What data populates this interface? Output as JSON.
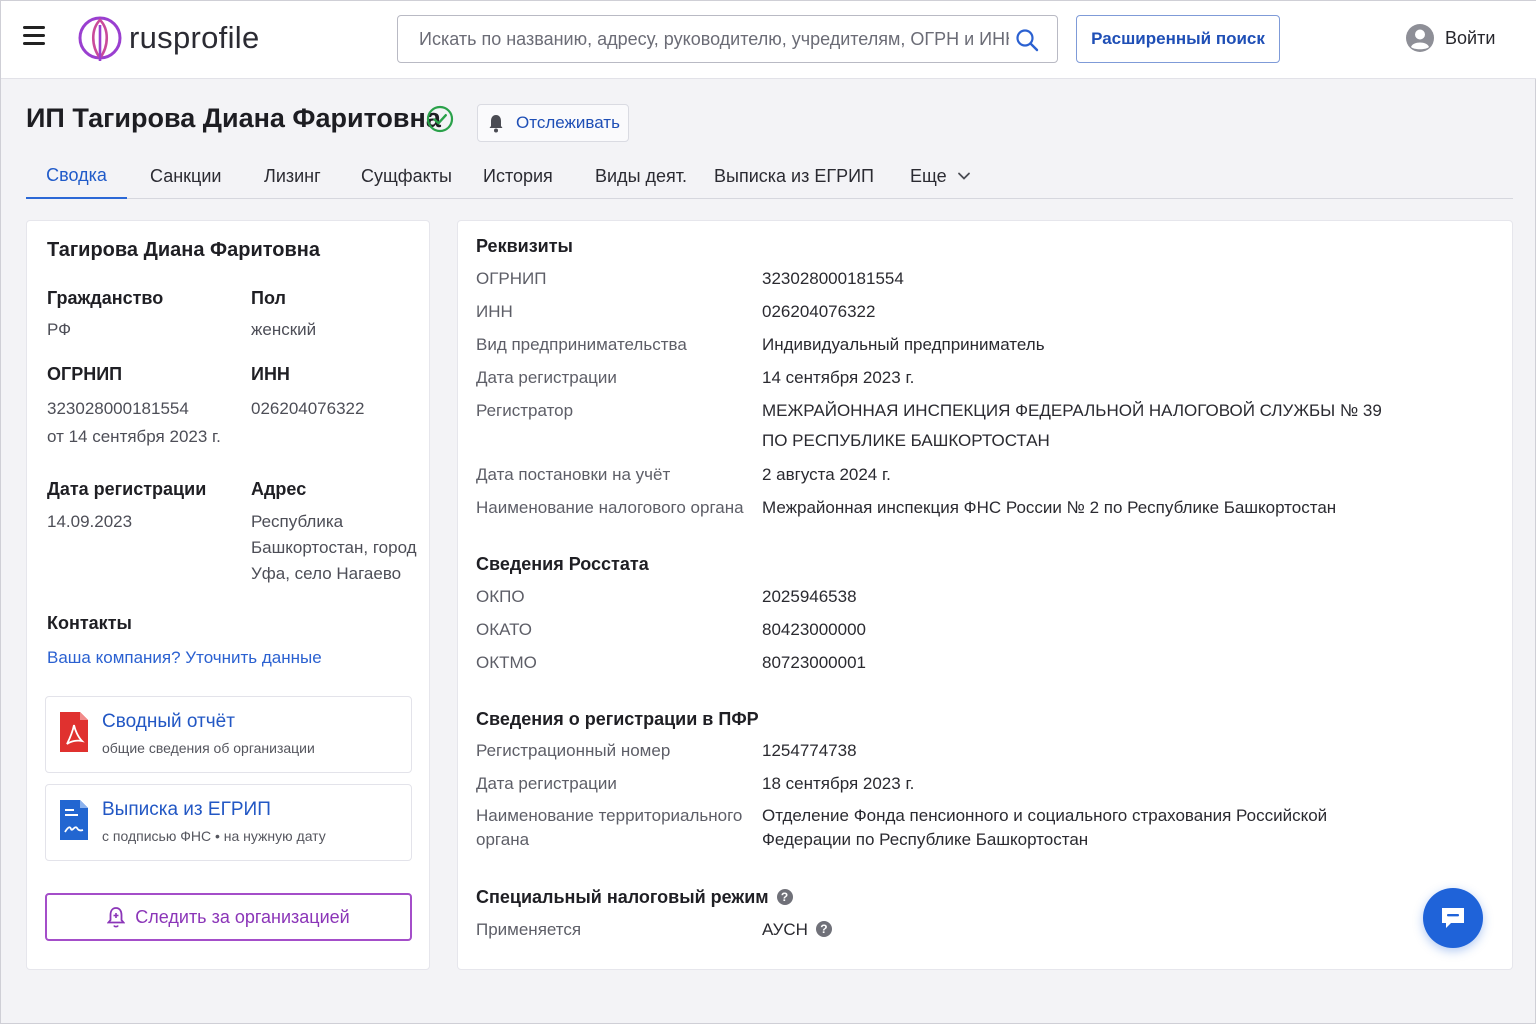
{
  "header": {
    "logo_text": "rusprofile",
    "search_placeholder": "Искать по названию, адресу, руководителю, учредителям, ОГРН и ИНН",
    "advanced_search_label": "Расширенный поиск",
    "login_label": "Войти"
  },
  "page": {
    "title": "ИП Тагирова Диана Фаритовна",
    "track_label": "Отслеживать"
  },
  "tabs": [
    {
      "label": "Сводка",
      "active": true
    },
    {
      "label": "Санкции"
    },
    {
      "label": "Лизинг"
    },
    {
      "label": "Сущфакты"
    },
    {
      "label": "История"
    },
    {
      "label": "Виды деят."
    },
    {
      "label": "Выписка из ЕГРИП"
    },
    {
      "label": "Еще"
    }
  ],
  "left": {
    "owner_name": "Тагирова Диана Фаритовна",
    "citizenship_label": "Гражданство",
    "citizenship_value": "РФ",
    "gender_label": "Пол",
    "gender_value": "женский",
    "ogrnip_label": "ОГРНИП",
    "ogrnip_value": "323028000181554",
    "ogrnip_date": "от 14 сентября 2023 г.",
    "inn_label": "ИНН",
    "inn_value": "026204076322",
    "reg_date_label": "Дата регистрации",
    "reg_date_value": "14.09.2023",
    "address_label": "Адрес",
    "address_lines": [
      "Республика",
      "Башкортостан, город",
      "Уфа, село Нагаево"
    ],
    "contacts_label": "Контакты",
    "contacts_link": "Ваша компания? Уточнить данные",
    "report_title": "Сводный отчёт",
    "report_sub": "общие сведения об организации",
    "extract_title": "Выписка из ЕГРИП",
    "extract_sub": "с подписью ФНС • на нужную дату",
    "follow_label": "Следить за организацией"
  },
  "right": {
    "requisites_title": "Реквизиты",
    "requisites": [
      {
        "key": "ОГРНИП",
        "value": "323028000181554"
      },
      {
        "key": "ИНН",
        "value": "026204076322"
      },
      {
        "key": "Вид предпринимательства",
        "value": "Индивидуальный предприниматель"
      },
      {
        "key": "Дата регистрации",
        "value": "14 сентября 2023 г."
      },
      {
        "key": "Регистратор",
        "value": "МЕЖРАЙОННАЯ ИНСПЕКЦИЯ ФЕДЕРАЛЬНОЙ НАЛОГОВОЙ СЛУЖБЫ № 39",
        "value2": "ПО РЕСПУБЛИКЕ БАШКОРТОСТАН"
      },
      {
        "key": "Дата постановки на учёт",
        "value": "2 августа 2024 г."
      },
      {
        "key": "Наименование налогового органа",
        "value": "Межрайонная инспекция ФНС России № 2 по Республике Башкортостан"
      }
    ],
    "rosstat_title": "Сведения Росстата",
    "rosstat": [
      {
        "key": "ОКПО",
        "value": "2025946538"
      },
      {
        "key": "ОКАТО",
        "value": "80423000000"
      },
      {
        "key": "ОКТМО",
        "value": "80723000001"
      }
    ],
    "pfr_title": "Сведения о регистрации в ПФР",
    "pfr": [
      {
        "key": "Регистрационный номер",
        "value": "1254774738"
      },
      {
        "key": "Дата регистрации",
        "value": "18 сентября 2023 г."
      },
      {
        "key": "Наименование территориального",
        "key2": "органа",
        "value": "Отделение Фонда пенсионного и социального страхования Российской",
        "value2": "Федерации по Республике Башкортостан"
      }
    ],
    "tax_title": "Специальный налоговый режим",
    "tax_key": "Применяется",
    "tax_value": "АУСН",
    "help_glyph": "?"
  },
  "colors": {
    "accent": "#1f5ac9",
    "follow": "#8b35b8",
    "verified": "#2aa14a",
    "pdf_red": "#e0312f",
    "doc_blue": "#2266d1"
  }
}
